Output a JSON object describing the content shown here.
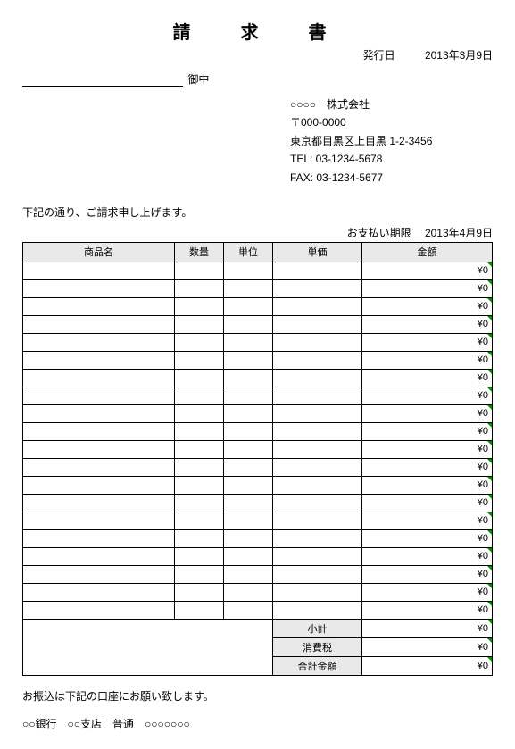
{
  "title": "請　求　書",
  "issue": {
    "label": "発行日",
    "value": "2013年3月9日"
  },
  "addressee": {
    "honorific": "御中"
  },
  "company": {
    "name": "○○○○　株式会社",
    "postal": "〒000-0000",
    "address": "東京都目黒区上目黒 1-2-3456",
    "tel": "TEL: 03-1234-5678",
    "fax": "FAX: 03-1234-5677"
  },
  "intro": "下記の通り、ご請求申し上げます。",
  "due": {
    "label": "お支払い期限",
    "value": "2013年4月9日"
  },
  "headers": {
    "name": "商品名",
    "qty": "数量",
    "unit": "単位",
    "price": "単価",
    "amount": "金額"
  },
  "rows": [
    {
      "name": "",
      "qty": "",
      "unit": "",
      "price": "",
      "amount": "¥0"
    },
    {
      "name": "",
      "qty": "",
      "unit": "",
      "price": "",
      "amount": "¥0"
    },
    {
      "name": "",
      "qty": "",
      "unit": "",
      "price": "",
      "amount": "¥0"
    },
    {
      "name": "",
      "qty": "",
      "unit": "",
      "price": "",
      "amount": "¥0"
    },
    {
      "name": "",
      "qty": "",
      "unit": "",
      "price": "",
      "amount": "¥0"
    },
    {
      "name": "",
      "qty": "",
      "unit": "",
      "price": "",
      "amount": "¥0"
    },
    {
      "name": "",
      "qty": "",
      "unit": "",
      "price": "",
      "amount": "¥0"
    },
    {
      "name": "",
      "qty": "",
      "unit": "",
      "price": "",
      "amount": "¥0"
    },
    {
      "name": "",
      "qty": "",
      "unit": "",
      "price": "",
      "amount": "¥0"
    },
    {
      "name": "",
      "qty": "",
      "unit": "",
      "price": "",
      "amount": "¥0"
    },
    {
      "name": "",
      "qty": "",
      "unit": "",
      "price": "",
      "amount": "¥0"
    },
    {
      "name": "",
      "qty": "",
      "unit": "",
      "price": "",
      "amount": "¥0"
    },
    {
      "name": "",
      "qty": "",
      "unit": "",
      "price": "",
      "amount": "¥0"
    },
    {
      "name": "",
      "qty": "",
      "unit": "",
      "price": "",
      "amount": "¥0"
    },
    {
      "name": "",
      "qty": "",
      "unit": "",
      "price": "",
      "amount": "¥0"
    },
    {
      "name": "",
      "qty": "",
      "unit": "",
      "price": "",
      "amount": "¥0"
    },
    {
      "name": "",
      "qty": "",
      "unit": "",
      "price": "",
      "amount": "¥0"
    },
    {
      "name": "",
      "qty": "",
      "unit": "",
      "price": "",
      "amount": "¥0"
    },
    {
      "name": "",
      "qty": "",
      "unit": "",
      "price": "",
      "amount": "¥0"
    },
    {
      "name": "",
      "qty": "",
      "unit": "",
      "price": "",
      "amount": "¥0"
    }
  ],
  "summary": {
    "subtotal": {
      "label": "小計",
      "value": "¥0"
    },
    "tax": {
      "label": "消費税",
      "value": "¥0"
    },
    "total": {
      "label": "合計金額",
      "value": "¥0"
    }
  },
  "bank": {
    "note": "お振込は下記の口座にお願い致します。",
    "detail": "○○銀行　○○支店　普通　○○○○○○○"
  }
}
